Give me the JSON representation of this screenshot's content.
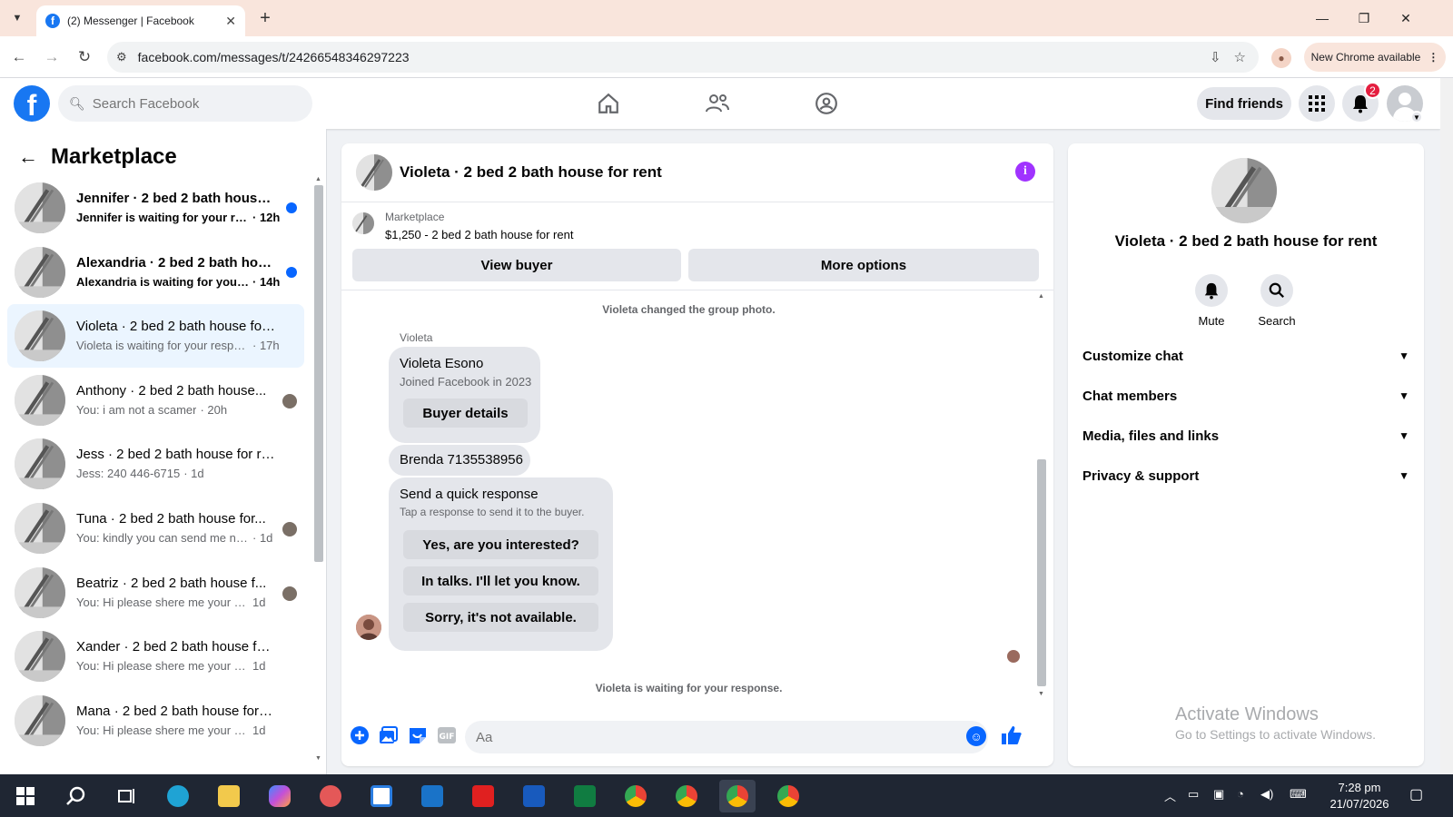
{
  "browser": {
    "tab_title": "(2) Messenger | Facebook",
    "url": "facebook.com/messages/t/24266548346297223",
    "update_chip": "New Chrome available"
  },
  "fb": {
    "logo": "f",
    "search_placeholder": "Search Facebook",
    "find_friends": "Find friends",
    "notification_count": "2",
    "brand_color": "#1877f2"
  },
  "sidebar": {
    "title": "Marketplace",
    "conversations": [
      {
        "name": "Jennifer · 2 bed 2 bath house f...",
        "preview": "Jennifer is waiting for your res...",
        "time": "· 12h",
        "unread": true
      },
      {
        "name": "Alexandria · 2 bed 2 bath hou...",
        "preview": "Alexandria is waiting for your ...",
        "time": "· 14h",
        "unread": true
      },
      {
        "name": "Violeta · 2 bed 2 bath house for ...",
        "preview": "Violeta is waiting for your respon...",
        "time": "· 17h",
        "unread": false,
        "active": true
      },
      {
        "name": "Anthony · 2 bed 2 bath house...",
        "preview": "You: i am not a scamer",
        "time": "· 20h",
        "unread": false
      },
      {
        "name": "Jess · 2 bed 2 bath house for rent",
        "preview": "Jess: 240 446-6715",
        "time": "· 1d",
        "unread": false
      },
      {
        "name": "Tuna · 2 bed 2 bath house for...",
        "preview": "You: kindly you can send me nu...",
        "time": "· 1d",
        "unread": false
      },
      {
        "name": "Beatriz · 2 bed 2 bath house f...",
        "preview": "You: Hi please shere me your co...",
        "time": "1d",
        "unread": false
      },
      {
        "name": "Xander · 2 bed 2 bath house for...",
        "preview": "You: Hi please shere me your conta...",
        "time": "1d",
        "unread": false
      },
      {
        "name": "Mana · 2 bed 2 bath house for r...",
        "preview": "You: Hi please shere me your conta...",
        "time": "1d",
        "unread": false
      }
    ]
  },
  "chat": {
    "title": "Violeta · 2 bed 2 bath house for rent",
    "listing_label": "Marketplace",
    "listing_price": "$1,250 - 2 bed 2 bath house for rent",
    "view_buyer": "View buyer",
    "more_options": "More options",
    "system_photo": "Violeta changed the group photo.",
    "sender": "Violeta",
    "profile_name": "Violeta Esono",
    "profile_joined": "Joined Facebook in 2023",
    "buyer_details": "Buyer details",
    "phone_msg": "Brenda 7135538956",
    "quick_title": "Send a quick response",
    "quick_sub": "Tap a response to send it to the buyer.",
    "quick_1": "Yes, are you interested?",
    "quick_2": "In talks. I'll let you know.",
    "quick_3": "Sorry, it's not available.",
    "waiting": "Violeta is waiting for your response.",
    "input_placeholder": "Aa",
    "gif_label": "GIF",
    "info_color": "#a033ff"
  },
  "panel": {
    "name": "Violeta · 2 bed 2 bath house for rent",
    "mute": "Mute",
    "search": "Search",
    "customize": "Customize chat",
    "members": "Chat members",
    "media": "Media, files and links",
    "privacy": "Privacy & support",
    "activate_1": "Activate Windows",
    "activate_2": "Go to Settings to activate Windows."
  },
  "taskbar": {
    "time": "7:28 pm",
    "date": "21/07/2026"
  }
}
